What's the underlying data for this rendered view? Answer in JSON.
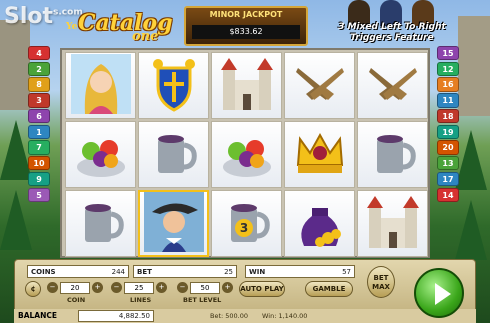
{
  "watermark": {
    "text": "Slot",
    "suffix": "s.com"
  },
  "logo": {
    "prefix": "Ye",
    "title": "Catalog",
    "suffix": "one"
  },
  "jackpot": {
    "title": "MINOR JACKPOT",
    "value": "$833.62"
  },
  "feature": {
    "line1": "3 Mixed Left To Right",
    "line2": "Triggers Feature"
  },
  "paylines": {
    "left": [
      "4",
      "2",
      "8",
      "3",
      "6",
      "1",
      "7",
      "10",
      "9",
      "5"
    ],
    "right": [
      "15",
      "12",
      "16",
      "11",
      "18",
      "19",
      "20",
      "13",
      "17",
      "14"
    ],
    "left_colors": [
      "#d63131",
      "#4aa33a",
      "#e0a019",
      "#c0392b",
      "#8e44ad",
      "#2e86c1",
      "#27ae60",
      "#d35400",
      "#16a085",
      "#9b59b6"
    ],
    "right_colors": [
      "#8e44ad",
      "#27ae60",
      "#e67e22",
      "#2e86c1",
      "#c0392b",
      "#16a085",
      "#d35400",
      "#4aa33a",
      "#2e86c1",
      "#d63131"
    ]
  },
  "reels": [
    [
      "princess-icon",
      "fruit-bowl-icon",
      "mug-icon"
    ],
    [
      "coat-of-arms-icon",
      "mug-icon",
      "musketeer-icon"
    ],
    [
      "castle-icon",
      "fruit-bowl-icon",
      "mug-3-icon"
    ],
    [
      "pistols-icon",
      "crown-icon",
      "gold-bag-icon"
    ],
    [
      "pistols-icon",
      "mug-icon",
      "castle-icon"
    ]
  ],
  "panel": {
    "coins_label": "COINS",
    "coins_value": "244",
    "bet_label": "BET",
    "bet_value": "25",
    "win_label": "WIN",
    "win_value": "57",
    "coin_value": "20",
    "coin_label": "COIN",
    "lines_value": "25",
    "lines_label": "LINES",
    "bet_level_value": "50",
    "bet_level_label": "BET LEVEL",
    "autoplay_label": "AUTO PLAY",
    "gamble_label": "GAMBLE",
    "betmax_label1": "BET",
    "betmax_label2": "MAX",
    "balance_label": "BALANCE",
    "balance_value": "4,882.50",
    "bet_total": "Bet: 500.00",
    "win_total": "Win: 1,140.00"
  },
  "colors": {
    "spin": "#3aa61a",
    "panel": "#e2d6ad",
    "accent": "#d4a63a"
  }
}
